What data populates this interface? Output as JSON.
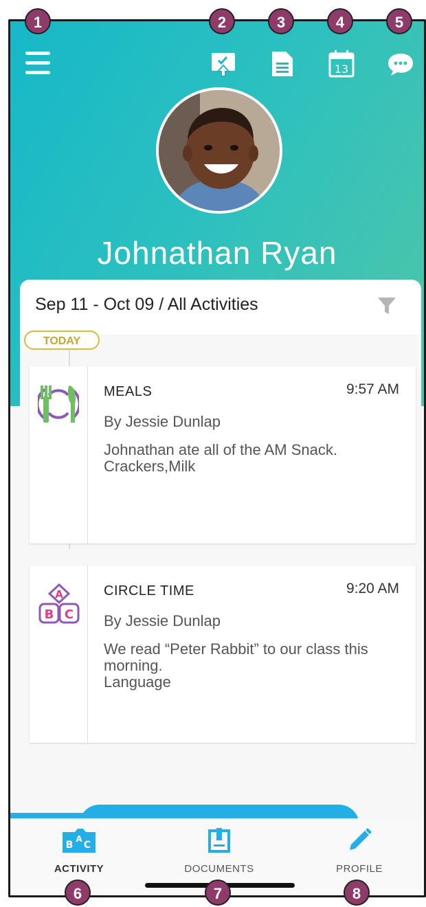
{
  "header": {
    "child_name": "Johnathan Ryan"
  },
  "top_icons": [
    "menu-icon",
    "check-in-icon",
    "document-icon",
    "calendar-icon",
    "chat-icon"
  ],
  "calendar_day": "13",
  "feed": {
    "range_label": "Sep 11 - Oct 09 / All Activities",
    "today_badge": "TODAY",
    "entries": [
      {
        "title": "MEALS",
        "time": "9:57 AM",
        "by": "By Jessie Dunlap",
        "note": "Johnathan ate all of the AM Snack.\nCrackers,Milk",
        "icon": "meal-icon"
      },
      {
        "title": "CIRCLE TIME",
        "time": "9:20 AM",
        "by": "By Jessie Dunlap",
        "note": "We read “Peter Rabbit” to our class this morning.\nLanguage",
        "icon": "abc-blocks-icon"
      }
    ]
  },
  "tabs": [
    {
      "label": "ACTIVITY",
      "icon": "activity-icon",
      "active": true
    },
    {
      "label": "DOCUMENTS",
      "icon": "documents-icon",
      "active": false
    },
    {
      "label": "PROFILE",
      "icon": "pencil-icon",
      "active": false
    }
  ],
  "callouts": [
    "1",
    "2",
    "3",
    "4",
    "5",
    "6",
    "7",
    "8"
  ],
  "colors": {
    "header_start": "#17b8c8",
    "header_end": "#4fc6a8",
    "accent_blue": "#22aee6",
    "callout": "#8e3b6a",
    "today_gold": "#d7bb3a"
  }
}
